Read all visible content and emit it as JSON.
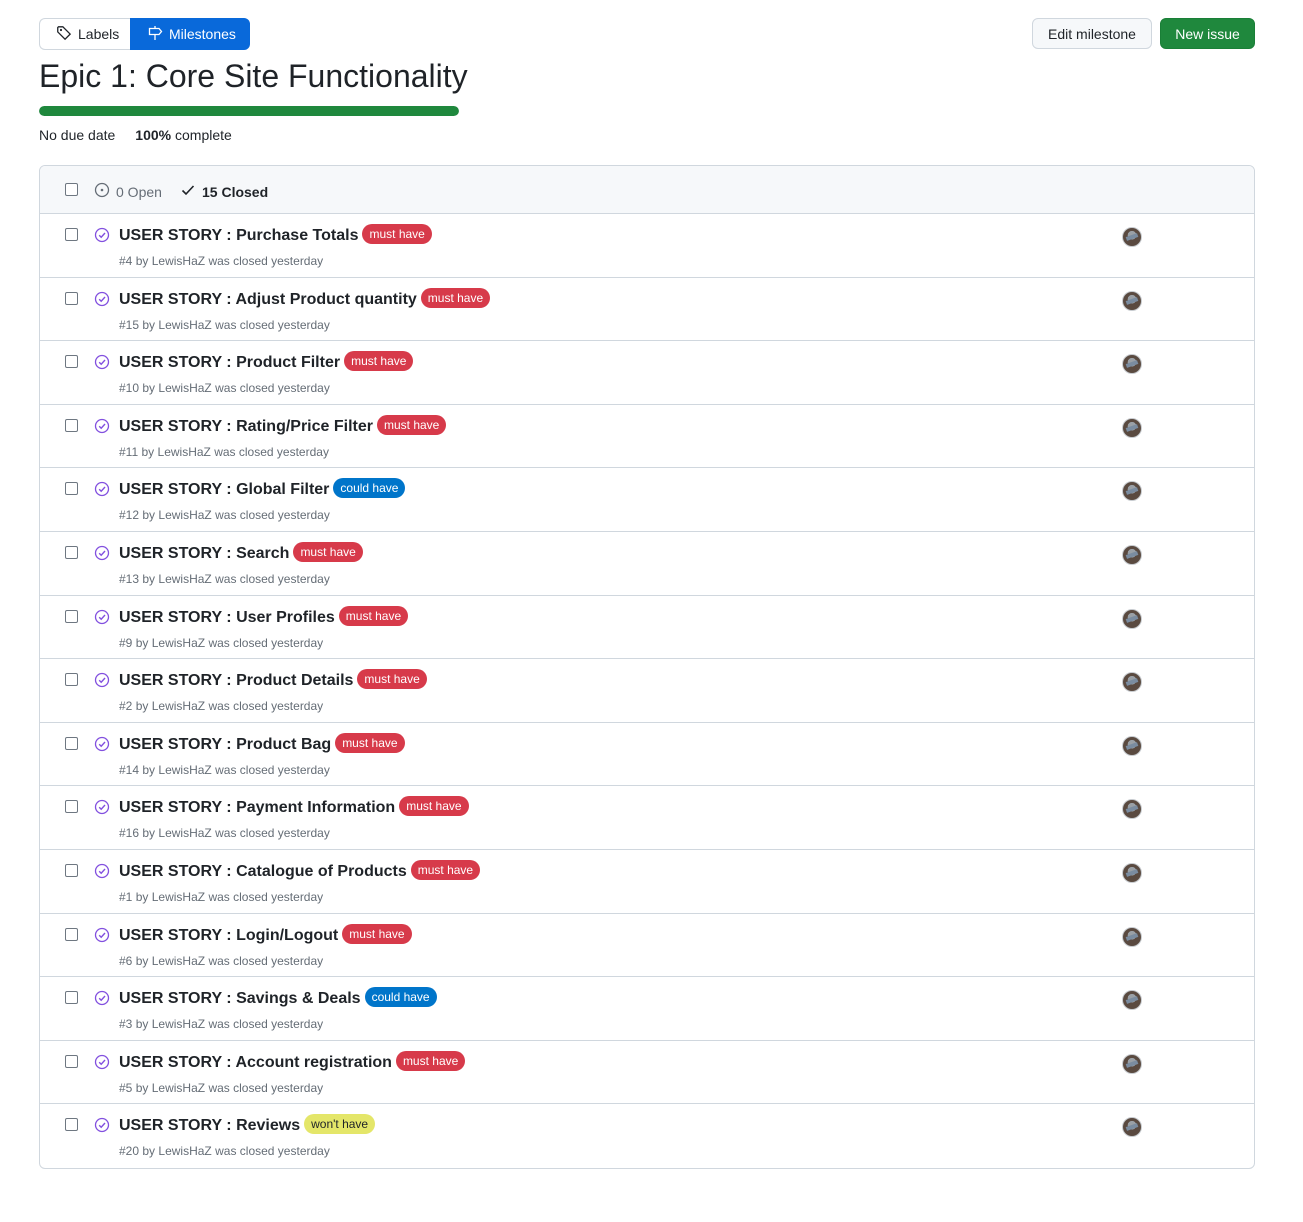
{
  "nav": {
    "labels": "Labels",
    "milestones": "Milestones"
  },
  "actions": {
    "edit": "Edit milestone",
    "new": "New issue"
  },
  "milestone": {
    "title": "Epic 1: Core Site Functionality",
    "due": "No due date",
    "percent": "100%",
    "complete_word": "complete",
    "progress_fraction": 1.0
  },
  "states": {
    "open": "0 Open",
    "closed": "15 Closed"
  },
  "colors": {
    "must have": {
      "bg": "#d73a4a",
      "fg": "#ffffff"
    },
    "could have": {
      "bg": "#0075ca",
      "fg": "#ffffff"
    },
    "won't have": {
      "bg": "#e4e669",
      "fg": "#1f2328"
    }
  },
  "issues": [
    {
      "title": "USER STORY : Purchase Totals",
      "label": "must have",
      "number": "#4",
      "by": "by",
      "author": "LewisHaZ",
      "status": "was closed yesterday"
    },
    {
      "title": "USER STORY : Adjust Product quantity",
      "label": "must have",
      "number": "#15",
      "by": "by",
      "author": "LewisHaZ",
      "status": "was closed yesterday"
    },
    {
      "title": "USER STORY : Product Filter",
      "label": "must have",
      "number": "#10",
      "by": "by",
      "author": "LewisHaZ",
      "status": "was closed yesterday"
    },
    {
      "title": "USER STORY : Rating/Price Filter",
      "label": "must have",
      "number": "#11",
      "by": "by",
      "author": "LewisHaZ",
      "status": "was closed yesterday"
    },
    {
      "title": "USER STORY : Global Filter",
      "label": "could have",
      "number": "#12",
      "by": "by",
      "author": "LewisHaZ",
      "status": "was closed yesterday"
    },
    {
      "title": "USER STORY : Search",
      "label": "must have",
      "number": "#13",
      "by": "by",
      "author": "LewisHaZ",
      "status": "was closed yesterday"
    },
    {
      "title": "USER STORY : User Profiles",
      "label": "must have",
      "number": "#9",
      "by": "by",
      "author": "LewisHaZ",
      "status": "was closed yesterday"
    },
    {
      "title": "USER STORY : Product Details",
      "label": "must have",
      "number": "#2",
      "by": "by",
      "author": "LewisHaZ",
      "status": "was closed yesterday"
    },
    {
      "title": "USER STORY : Product Bag",
      "label": "must have",
      "number": "#14",
      "by": "by",
      "author": "LewisHaZ",
      "status": "was closed yesterday"
    },
    {
      "title": "USER STORY : Payment Information",
      "label": "must have",
      "number": "#16",
      "by": "by",
      "author": "LewisHaZ",
      "status": "was closed yesterday"
    },
    {
      "title": "USER STORY : Catalogue of Products",
      "label": "must have",
      "number": "#1",
      "by": "by",
      "author": "LewisHaZ",
      "status": "was closed yesterday"
    },
    {
      "title": "USER STORY : Login/Logout",
      "label": "must have",
      "number": "#6",
      "by": "by",
      "author": "LewisHaZ",
      "status": "was closed yesterday"
    },
    {
      "title": "USER STORY : Savings & Deals",
      "label": "could have",
      "number": "#3",
      "by": "by",
      "author": "LewisHaZ",
      "status": "was closed yesterday"
    },
    {
      "title": "USER STORY : Account registration",
      "label": "must have",
      "number": "#5",
      "by": "by",
      "author": "LewisHaZ",
      "status": "was closed yesterday"
    },
    {
      "title": "USER STORY : Reviews",
      "label": "won't have",
      "number": "#20",
      "by": "by",
      "author": "LewisHaZ",
      "status": "was closed yesterday"
    }
  ]
}
